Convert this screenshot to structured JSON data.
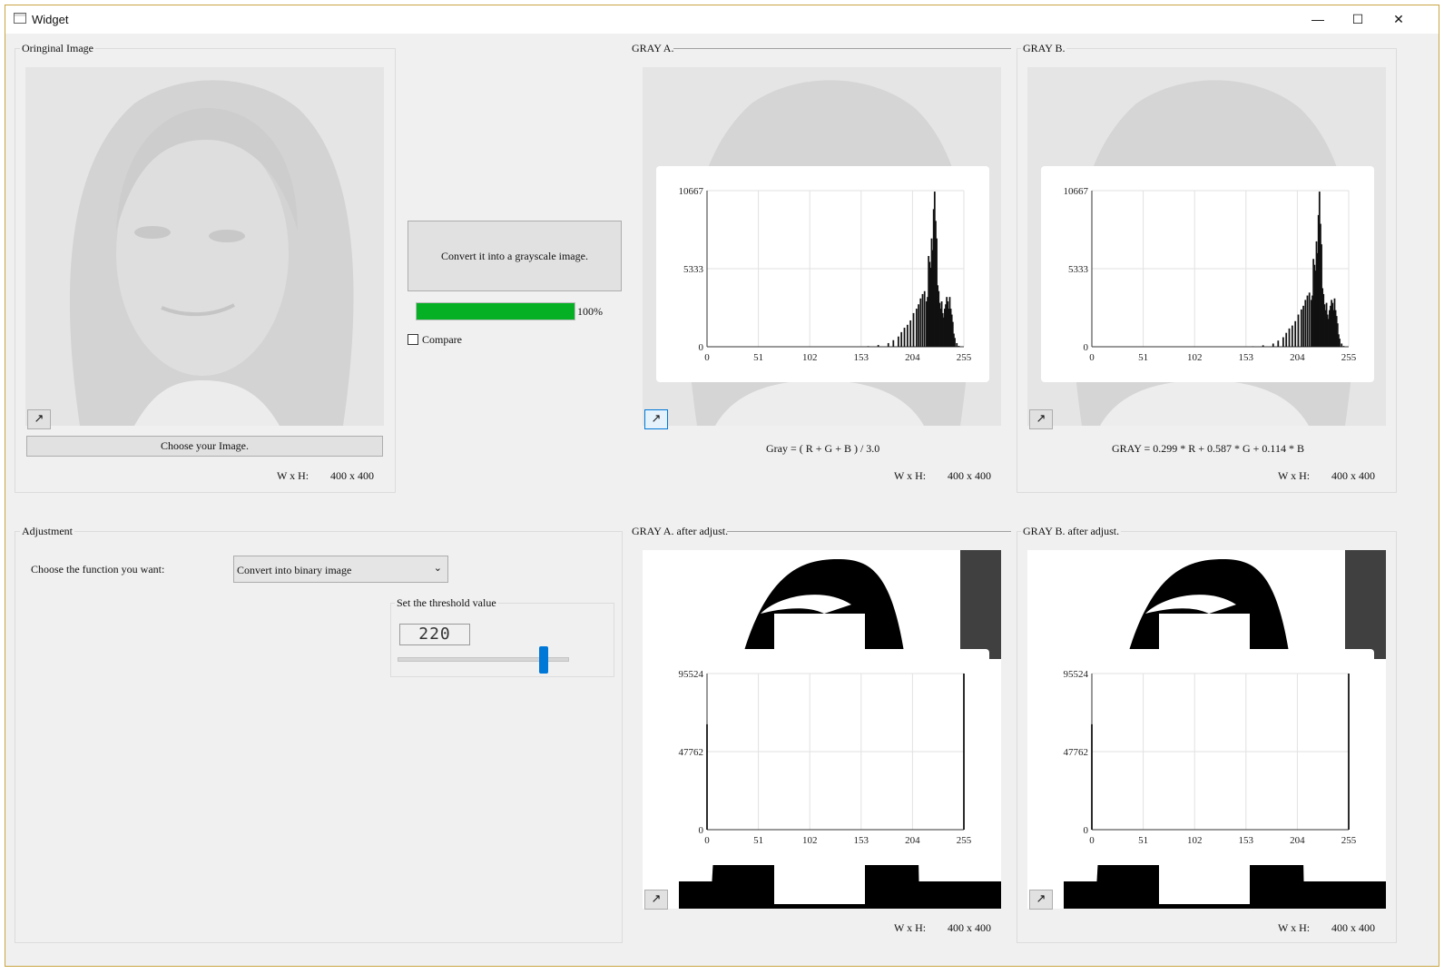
{
  "window": {
    "title": "Widget",
    "minimize_glyph": "—",
    "maximize_glyph": "☐",
    "close_glyph": "✕"
  },
  "original": {
    "group_label": "Oringinal Image",
    "choose_button": "Choose your Image.",
    "size_label": "W x H:",
    "size_value": "400 x 400"
  },
  "convert": {
    "button_label": "Convert it into a grayscale image.",
    "progress": 100,
    "progress_text": "100%",
    "compare_label": "Compare",
    "compare_checked": false
  },
  "gray_a": {
    "group_label": "GRAY A.",
    "formula": "Gray = ( R + G + B ) / 3.0",
    "size_label": "W x H:",
    "size_value": "400 x 400"
  },
  "gray_b": {
    "group_label": "GRAY B.",
    "formula": "GRAY = 0.299 * R + 0.587 * G + 0.114 * B",
    "size_label": "W x H:",
    "size_value": "400 x 400"
  },
  "adjustment": {
    "group_label": "Adjustment",
    "function_label": "Choose the function you want:",
    "function_selected": "Convert into binary image",
    "threshold_group_label": "Set the threshold value",
    "threshold_value": "220",
    "slider_min": 0,
    "slider_max": 255,
    "slider_value": 220
  },
  "gray_a_adj": {
    "group_label": "GRAY A. after adjust.",
    "size_label": "W x H:",
    "size_value": "400 x 400"
  },
  "gray_b_adj": {
    "group_label": "GRAY B. after adjust.",
    "size_label": "W x H:",
    "size_value": "400 x 400"
  },
  "icons": {
    "expand": "expand-arrow-icon",
    "dropdown": "chevron-down-icon"
  },
  "colors": {
    "progress_fill": "#06b025",
    "slider_thumb": "#0078d7",
    "active_border": "#0078d7"
  },
  "chart_data": [
    {
      "type": "bar",
      "ylim": [
        0,
        10667
      ],
      "yticks": [
        "0",
        "5333",
        "10667"
      ],
      "xticks": [
        "0",
        "51",
        "102",
        "153",
        "204",
        "255"
      ],
      "xlim": [
        0,
        255
      ],
      "grid": true,
      "x": [
        160,
        170,
        180,
        185,
        190,
        193,
        196,
        199,
        202,
        205,
        208,
        210,
        212,
        214,
        216,
        218,
        219,
        220,
        221,
        222,
        223,
        224,
        225,
        226,
        227,
        228,
        229,
        230,
        231,
        232,
        233,
        234,
        235,
        236,
        237,
        238,
        239,
        240,
        241,
        242,
        243,
        244,
        245,
        246,
        248,
        250
      ],
      "values": [
        40,
        120,
        250,
        450,
        700,
        1000,
        1300,
        1500,
        1800,
        2300,
        2600,
        2900,
        3300,
        3600,
        3800,
        3100,
        3400,
        6200,
        5800,
        5400,
        7400,
        6600,
        9400,
        10600,
        8600,
        7400,
        4200,
        3800,
        3000,
        2600,
        3100,
        2300,
        2000,
        2600,
        2900,
        3400,
        3100,
        2600,
        3400,
        2600,
        2200,
        1700,
        900,
        600,
        250,
        60
      ]
    },
    {
      "type": "bar",
      "ylim": [
        0,
        10667
      ],
      "yticks": [
        "0",
        "5333",
        "10667"
      ],
      "xticks": [
        "0",
        "51",
        "102",
        "153",
        "204",
        "255"
      ],
      "xlim": [
        0,
        255
      ],
      "grid": true,
      "x": [
        160,
        170,
        180,
        185,
        190,
        193,
        196,
        199,
        202,
        205,
        208,
        210,
        212,
        214,
        216,
        218,
        219,
        220,
        221,
        222,
        223,
        224,
        225,
        226,
        227,
        228,
        229,
        230,
        231,
        232,
        233,
        234,
        235,
        236,
        237,
        238,
        239,
        240,
        241,
        242,
        243,
        244,
        245,
        246,
        248,
        250
      ],
      "values": [
        30,
        100,
        220,
        420,
        650,
        950,
        1250,
        1450,
        1750,
        2200,
        2550,
        2800,
        3200,
        3500,
        3700,
        3200,
        3500,
        6000,
        5600,
        5200,
        7200,
        6400,
        9000,
        10600,
        8400,
        7000,
        4000,
        3600,
        2900,
        2500,
        3000,
        2200,
        1900,
        2500,
        2800,
        3200,
        3000,
        2500,
        3300,
        2500,
        2100,
        1600,
        850,
        550,
        220,
        50
      ]
    },
    {
      "type": "bar",
      "ylim": [
        0,
        95524
      ],
      "yticks": [
        "0",
        "47762",
        "95524"
      ],
      "xticks": [
        "0",
        "51",
        "102",
        "153",
        "204",
        "255"
      ],
      "xlim": [
        0,
        255
      ],
      "grid": true,
      "x": [
        0,
        255
      ],
      "values": [
        64476,
        95524
      ]
    },
    {
      "type": "bar",
      "ylim": [
        0,
        95524
      ],
      "yticks": [
        "0",
        "47762",
        "95524"
      ],
      "xticks": [
        "0",
        "51",
        "102",
        "153",
        "204",
        "255"
      ],
      "xlim": [
        0,
        255
      ],
      "grid": true,
      "x": [
        0,
        255
      ],
      "values": [
        64476,
        95524
      ]
    }
  ]
}
